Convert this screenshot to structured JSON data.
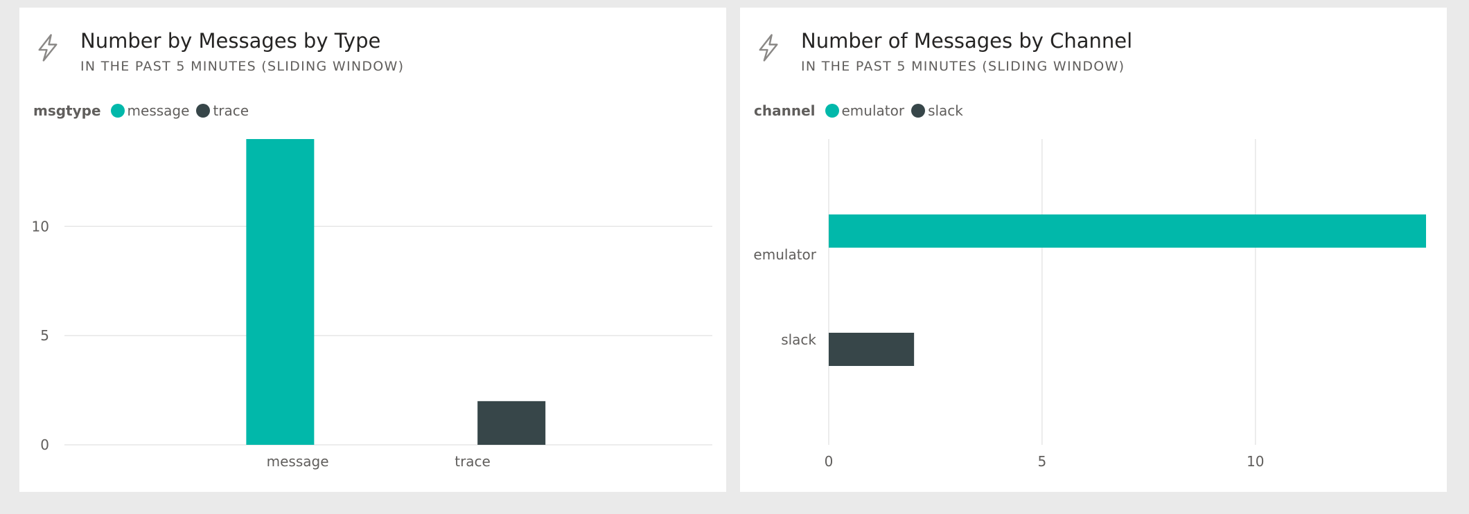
{
  "colors": {
    "message": "#01b8aa",
    "trace": "#374649",
    "grid": "#e6e6e6"
  },
  "tiles": [
    {
      "title": "Number by Messages by Type",
      "subtitle": "IN THE PAST 5 MINUTES (SLIDING WINDOW)",
      "icon": "lightning-bolt-icon",
      "legend": {
        "title": "msgtype",
        "items": [
          "message",
          "trace"
        ]
      }
    },
    {
      "title": "Number of Messages by Channel",
      "subtitle": "IN THE PAST 5 MINUTES (SLIDING WINDOW)",
      "icon": "lightning-bolt-icon",
      "legend": {
        "title": "channel",
        "items": [
          "emulator",
          "slack"
        ]
      }
    }
  ],
  "chart_data": [
    {
      "type": "bar",
      "orientation": "vertical",
      "title": "Number by Messages by Type",
      "subtitle": "IN THE PAST 5 MINUTES (SLIDING WINDOW)",
      "legend_title": "msgtype",
      "legend_placement": "top-left",
      "categories": [
        "message",
        "trace"
      ],
      "values": [
        14,
        2
      ],
      "y_ticks": [
        0,
        5,
        10
      ],
      "ylim": [
        0,
        14
      ],
      "grid": true
    },
    {
      "type": "bar",
      "orientation": "horizontal",
      "title": "Number of Messages by Channel",
      "subtitle": "IN THE PAST 5 MINUTES (SLIDING WINDOW)",
      "legend_title": "channel",
      "legend_placement": "top-left",
      "categories": [
        "emulator",
        "slack"
      ],
      "values": [
        14,
        2
      ],
      "x_ticks": [
        0,
        5,
        10
      ],
      "xlim": [
        0,
        14
      ],
      "grid": true
    }
  ]
}
